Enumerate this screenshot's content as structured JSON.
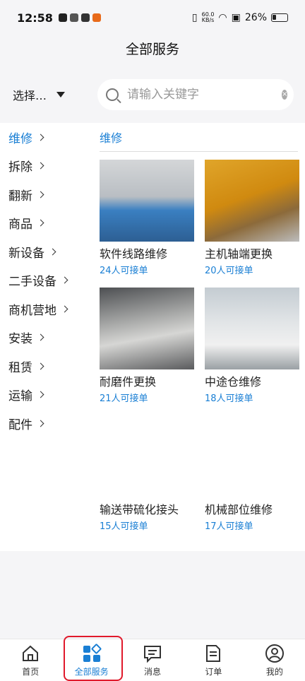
{
  "status_bar": {
    "time": "12:58",
    "net_speed": "60.0",
    "net_unit": "KB/s",
    "battery": "26%"
  },
  "header": {
    "title": "全部服务"
  },
  "filter": {
    "selector_label": "选择…",
    "search_placeholder": "请输入关键字",
    "search_value": ""
  },
  "sidebar": {
    "items": [
      {
        "label": "维修",
        "active": true
      },
      {
        "label": "拆除"
      },
      {
        "label": "翻新"
      },
      {
        "label": "商品"
      },
      {
        "label": "新设备"
      },
      {
        "label": "二手设备"
      },
      {
        "label": "商机营地"
      },
      {
        "label": "安装"
      },
      {
        "label": "租赁"
      },
      {
        "label": "运输"
      },
      {
        "label": "配件"
      }
    ]
  },
  "main": {
    "section_title": "维修",
    "services": [
      {
        "name": "软件线路维修",
        "count": "24人可接单",
        "image": "control-cabinet-image"
      },
      {
        "name": "主机轴端更换",
        "count": "20人可接单",
        "image": "mixer-machine-image"
      },
      {
        "name": "耐磨件更换",
        "count": "21人可接单",
        "image": "wear-parts-image"
      },
      {
        "name": "中途仓维修",
        "count": "18人可接单",
        "image": "storage-bin-image"
      },
      {
        "name": "输送带硫化接头",
        "count": "15人可接单",
        "image": ""
      },
      {
        "name": "机械部位维修",
        "count": "17人可接单",
        "image": ""
      }
    ]
  },
  "tabbar": {
    "tabs": [
      {
        "label": "首页",
        "icon": "home-icon"
      },
      {
        "label": "全部服务",
        "icon": "grid-icon",
        "active": true
      },
      {
        "label": "消息",
        "icon": "message-icon"
      },
      {
        "label": "订单",
        "icon": "order-icon"
      },
      {
        "label": "我的",
        "icon": "profile-icon"
      }
    ]
  },
  "colors": {
    "accent": "#1a7fd4",
    "highlight_border": "#e0192b"
  }
}
